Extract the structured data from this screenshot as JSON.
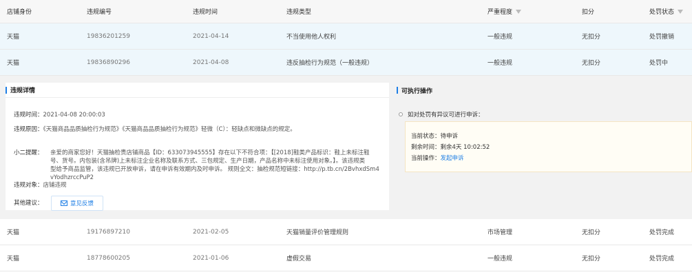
{
  "columns": [
    "店铺身份",
    "违规编号",
    "违规时间",
    "违规类型",
    "严重程度",
    "扣分",
    "处罚状态"
  ],
  "rows": [
    [
      "天猫",
      "19836201259",
      "2021-04-14",
      "不当使用他人权利",
      "一般违规",
      "无扣分",
      "处罚撤销"
    ],
    [
      "天猫",
      "19836890296",
      "2021-04-08",
      "违反抽检行为规范（一般违规）",
      "一般违规",
      "无扣分",
      "处罚中"
    ],
    [
      "天猫",
      "19176897210",
      "2021-02-05",
      "天猫销量评价管理规则",
      "市场管理",
      "无扣分",
      "处罚完成"
    ],
    [
      "天猫",
      "18778600205",
      "2021-01-06",
      "虚假交易",
      "一般违规",
      "无扣分",
      "处罚完成"
    ]
  ],
  "details": {
    "title": "违规详情",
    "time_label": "违规时间：",
    "time_value": "2021-04-08 20:00:03",
    "cause_label": "违规原因：",
    "cause_value": "《天猫商品品质抽检行为规范》《天猫商品品质抽检行为规范》轻微（C）：轻缺点和微缺点的规定。",
    "tip_label": "小二提醒：",
    "tip_lines": [
      "亲爱的商家您好！天猫抽检贵店铺商品【ID：633073945555】存在以下不符合项：【[2018]鞋类产品标识：鞋上未标注鞋",
      "号、货号。内包装(含吊牌)上未标注企业名称及联系方式、三包规定、生产日期，产品名称中未标注使用对象。】。该违规类",
      "型给予商品监管，该违规已开放申诉，请在申诉有效期内及时申诉。 规则全文：抽检规范短链接：http://p.tb.cn/2BvhxdSm4",
      "vYodhzrccPuP2"
    ],
    "target_label": "违规对象：",
    "target_value": "店铺违规",
    "suggest_label": "其他建议：",
    "feedback_button": "意见反馈"
  },
  "actions": {
    "title": "可执行操作",
    "appeal_label": "如对处罚有异议可进行申诉：",
    "status_label": "当前状态：",
    "status_value": "待申诉",
    "remaining_label": "剩余时间：",
    "remaining_value": "剩余4天 10:02:52",
    "op_label": "当前操作：",
    "op_link": "发起申诉"
  },
  "colors": {
    "accent": "#1d7ee5",
    "row_highlight": "#eef7fc"
  }
}
